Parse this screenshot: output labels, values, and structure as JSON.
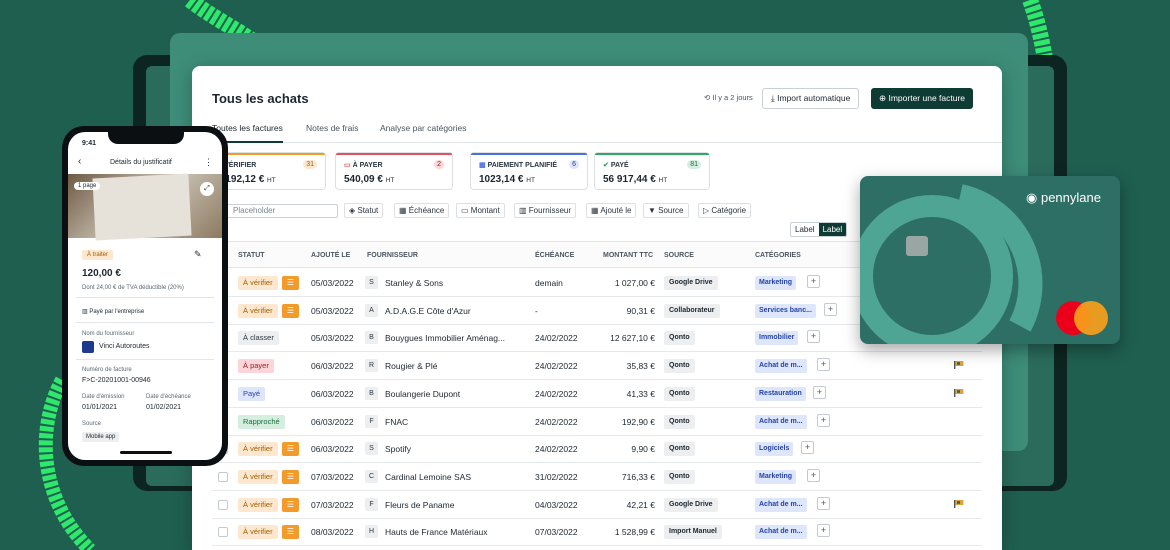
{
  "colors": {
    "background": "#1f5f50",
    "primary": "#0e3c34",
    "accent_green": "#2ee86b",
    "orange": "#f29b2b",
    "card": "#2d6f64"
  },
  "app": {
    "title": "Tous les achats",
    "history": "Il y a 2 jours",
    "import_auto": "Import automatique",
    "import_invoice": "Importer une facture"
  },
  "tabs": [
    "Toutes les factures",
    "Notes de frais",
    "Analyse par catégories"
  ],
  "summary": [
    {
      "label": "À VÉRIFIER",
      "count": "31",
      "amount": "3 192,12 €",
      "unit": "HT"
    },
    {
      "label": "À PAYER",
      "count": "2",
      "amount": "540,09 €",
      "unit": "HT"
    },
    {
      "label": "PAIEMENT PLANIFIÉ",
      "count": "6",
      "amount": "1023,14 €",
      "unit": "HT"
    },
    {
      "label": "PAYÉ",
      "count": "81",
      "amount": "56 917,44 €",
      "unit": "HT"
    }
  ],
  "search": {
    "placeholder": "Placeholder"
  },
  "filters": [
    "Statut",
    "Échéance",
    "Montant",
    "Fournisseur",
    "Ajouté le",
    "Source",
    "Catégorie"
  ],
  "label_toggle": [
    "Label",
    "Label"
  ],
  "columns": [
    "STATUT",
    "AJOUTÉ LE",
    "FOURNISSEUR",
    "ÉCHÉANCE",
    "MONTANT TTC",
    "SOURCE",
    "CATÉGORIES"
  ],
  "rows": [
    {
      "status": "À vérifier",
      "type": "verify",
      "date": "05/03/2022",
      "letter": "S",
      "supplier": "Stanley & Sons",
      "due": "demain",
      "amount": "1 027,00 €",
      "source": "Google Drive",
      "category": "Marketing",
      "flag": false
    },
    {
      "status": "À vérifier",
      "type": "verify",
      "date": "05/03/2022",
      "letter": "A",
      "supplier": "A.D.A.G.E Côte d'Azur",
      "due": "-",
      "amount": "90,31 €",
      "source": "Collaborateur",
      "category": "Services banc...",
      "flag": false
    },
    {
      "status": "À classer",
      "type": "classer",
      "date": "05/03/2022",
      "letter": "B",
      "supplier": "Bouygues Immobilier Aménag...",
      "due": "24/02/2022",
      "amount": "12 627,10 €",
      "source": "Qonto",
      "category": "Immobilier",
      "flag": false
    },
    {
      "status": "À payer",
      "type": "pay",
      "date": "06/03/2022",
      "letter": "R",
      "supplier": "Rougier & Plé",
      "due": "24/02/2022",
      "amount": "35,83 €",
      "source": "Qonto",
      "category": "Achat de m...",
      "flag": true
    },
    {
      "status": "Payé",
      "type": "paid",
      "date": "06/03/2022",
      "letter": "B",
      "supplier": "Boulangerie Dupont",
      "due": "24/02/2022",
      "amount": "41,33 €",
      "source": "Qonto",
      "category": "Restauration",
      "flag": true
    },
    {
      "status": "Rapproché",
      "type": "rappr",
      "date": "06/03/2022",
      "letter": "F",
      "supplier": "FNAC",
      "due": "24/02/2022",
      "amount": "192,90 €",
      "source": "Qonto",
      "category": "Achat de m...",
      "flag": false
    },
    {
      "status": "À vérifier",
      "type": "verify",
      "date": "06/03/2022",
      "letter": "S",
      "supplier": "Spotify",
      "due": "24/02/2022",
      "amount": "9,90 €",
      "source": "Qonto",
      "category": "Logiciels",
      "flag": false
    },
    {
      "status": "À vérifier",
      "type": "verify",
      "date": "07/03/2022",
      "letter": "C",
      "supplier": "Cardinal Lemoine SAS",
      "due": "31/02/2022",
      "amount": "716,33 €",
      "source": "Qonto",
      "category": "Marketing",
      "flag": false
    },
    {
      "status": "À vérifier",
      "type": "verify",
      "date": "07/03/2022",
      "letter": "F",
      "supplier": "Fleurs de Paname",
      "due": "04/03/2022",
      "amount": "42,21 €",
      "source": "Google Drive",
      "category": "Achat de m...",
      "flag": true
    },
    {
      "status": "À vérifier",
      "type": "verify",
      "date": "08/03/2022",
      "letter": "H",
      "supplier": "Hauts de France Matériaux",
      "due": "07/03/2022",
      "amount": "1 528,99 €",
      "source": "Import Manuel",
      "category": "Achat de m...",
      "flag": false
    }
  ],
  "card": {
    "brand": "pennylane"
  },
  "phone": {
    "time": "9:41",
    "title": "Détails du justificatif",
    "pages": "1 page",
    "status": "À traiter",
    "amount": "120,00 €",
    "vat": "Dont 24,00 € de TVA déductible (20%)",
    "paid_by": "Payé par l'entreprise",
    "supplier_label": "Nom du fournisseur",
    "supplier": "Vinci Autoroutes",
    "invoice_label": "Numéro de facture",
    "invoice": "F>C-20201001-00946",
    "issue_label": "Date d'émission",
    "issue": "01/01/2021",
    "due_label": "Date d'échéance",
    "due": "01/02/2021",
    "source_label": "Source",
    "source": "Mobile app"
  }
}
